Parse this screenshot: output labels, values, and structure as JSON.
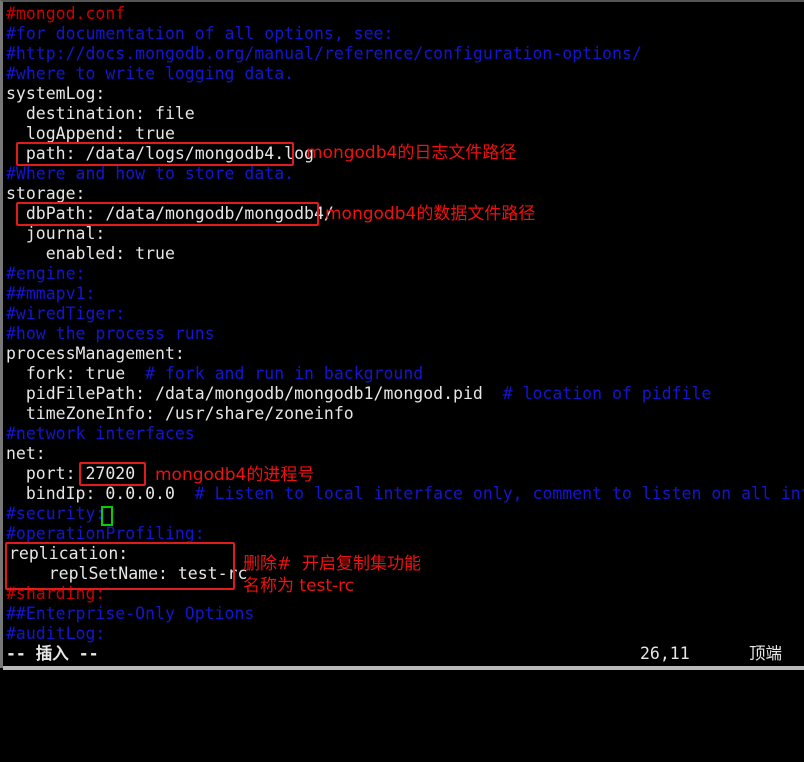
{
  "terminal": {
    "colors": {
      "background": "#000000",
      "comment": "#1515d0",
      "comment_red": "#cc0000",
      "text": "#e6e6e6",
      "annotation_red": "#ee1111",
      "box_red": "#e01b1b",
      "cursor_green": "#00d000"
    }
  },
  "lines": [
    {
      "text": "#mongod.conf",
      "color": "comment-red"
    },
    {
      "text": "#for documentation of all options, see:",
      "color": "comment"
    },
    {
      "text": "#http://docs.mongodb.org/manual/reference/configuration-options/",
      "color": "comment"
    },
    {
      "text": "#where to write logging data.",
      "color": "comment"
    },
    {
      "text": "systemLog:",
      "color": "plain"
    },
    {
      "text": "  destination: file",
      "color": "plain"
    },
    {
      "text": "  logAppend: true",
      "color": "plain"
    },
    {
      "text": "  path: /data/logs/mongodb4.log",
      "color": "plain"
    },
    {
      "text": "#Where and how to store data.",
      "color": "comment"
    },
    {
      "text": "storage:",
      "color": "plain"
    },
    {
      "text": "  dbPath: /data/mongodb/mongodb4/",
      "color": "plain"
    },
    {
      "text": "  journal:",
      "color": "plain"
    },
    {
      "text": "    enabled: true",
      "color": "plain"
    },
    {
      "text": "#engine:",
      "color": "comment"
    },
    {
      "text": "##mmapv1:",
      "color": "comment"
    },
    {
      "text": "#wiredTiger:",
      "color": "comment"
    },
    {
      "text": "#how the process runs",
      "color": "comment"
    },
    {
      "text": "processManagement:",
      "color": "plain"
    },
    {
      "text": "  fork: true",
      "color": "plain",
      "comment": "  # fork and run in background"
    },
    {
      "text": "  pidFilePath: /data/mongodb/mongodb1/mongod.pid",
      "color": "plain",
      "comment": "  # location of pidfile"
    },
    {
      "text": "  timeZoneInfo: /usr/share/zoneinfo",
      "color": "plain"
    },
    {
      "text": "#network interfaces",
      "color": "comment"
    },
    {
      "text": "net:",
      "color": "plain"
    },
    {
      "text": "  port: 27020",
      "color": "plain"
    },
    {
      "text": "  bindIp: 0.0.0.0",
      "color": "plain",
      "comment": "  # Listen to local interface only, comment to listen on all interfaces."
    },
    {
      "text": "#security:",
      "color": "comment"
    },
    {
      "text": "#operationProfiling:",
      "color": "comment"
    },
    {
      "text": "replication:",
      "color": "plain"
    },
    {
      "text": "    replSetName: test-rc",
      "color": "plain"
    },
    {
      "text": "#sharding:",
      "color": "comment-red"
    },
    {
      "text": "##Enterprise-Only Options",
      "color": "comment"
    },
    {
      "text": "#auditLog:",
      "color": "comment"
    }
  ],
  "annotations": [
    {
      "id": "log-path-note",
      "text": "mongodb4的日志文件路径"
    },
    {
      "id": "data-path-note",
      "text": "mongodb4的数据文件路径"
    },
    {
      "id": "port-note",
      "text": "mongodb4的进程号"
    },
    {
      "id": "replication-note-line1",
      "text": "删除#  开启复制集功能"
    },
    {
      "id": "replication-note-line2",
      "text": "名称为 test-rc"
    }
  ],
  "statusbar": {
    "mode": "-- 插入 --",
    "position": "26,11",
    "scroll": "顶端"
  }
}
